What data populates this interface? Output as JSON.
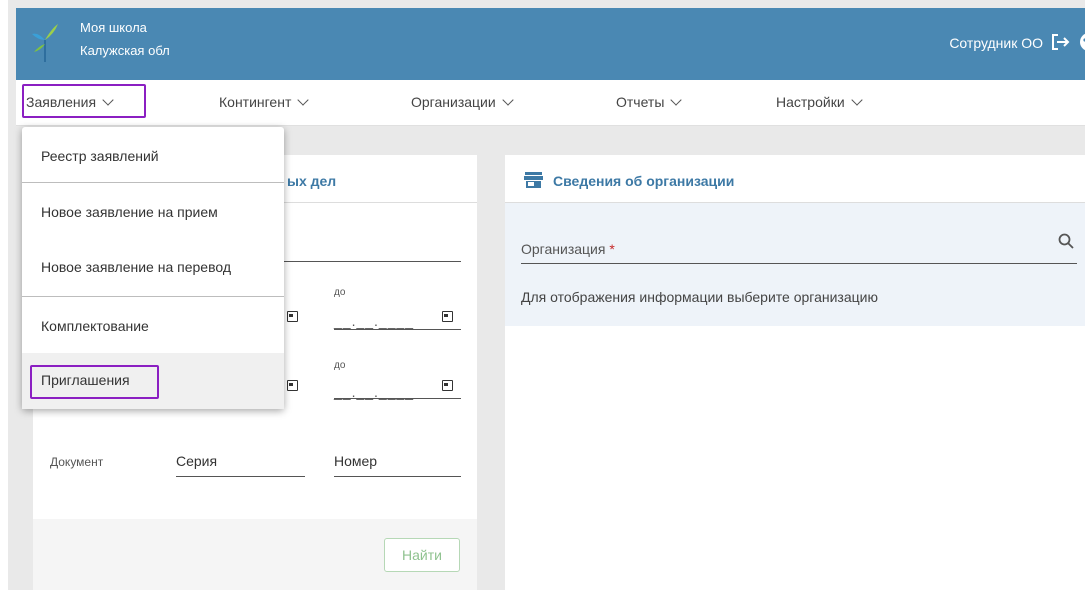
{
  "header": {
    "school": "Моя школа",
    "region": "Калужская обл",
    "user": "Сотрудник ОО",
    "color": "#4a88b3"
  },
  "nav": {
    "items": [
      {
        "label": "Заявления"
      },
      {
        "label": "Контингент"
      },
      {
        "label": "Организации"
      },
      {
        "label": "Отчеты"
      },
      {
        "label": "Настройки"
      }
    ],
    "highlight_color": "#8b1fc2"
  },
  "dropdown": {
    "items": [
      {
        "label": "Реестр заявлений"
      },
      {
        "label": "Новое заявление на прием"
      },
      {
        "label": "Новое заявление на перевод"
      },
      {
        "label": "Комплектование"
      },
      {
        "label": "Приглашения"
      }
    ]
  },
  "left_panel": {
    "title_visible": "ых дел",
    "to_label_1": "до",
    "to_label_2": "до",
    "date_mask": "__.__.____",
    "document_label": "Документ",
    "series_label": "Серия",
    "number_label": "Номер",
    "find_button": "Найти"
  },
  "right_panel": {
    "title": "Сведения об организации",
    "org_label": "Организация",
    "required_mark": "*",
    "hint": "Для отображения информации выберите организацию"
  },
  "icons": {
    "logo": "leaf-logo-icon",
    "exit": "logout-icon",
    "palette": "palette-icon",
    "store": "store-icon",
    "search": "search-icon",
    "calendar": "calendar-icon",
    "chevron": "chevron-down-icon"
  }
}
